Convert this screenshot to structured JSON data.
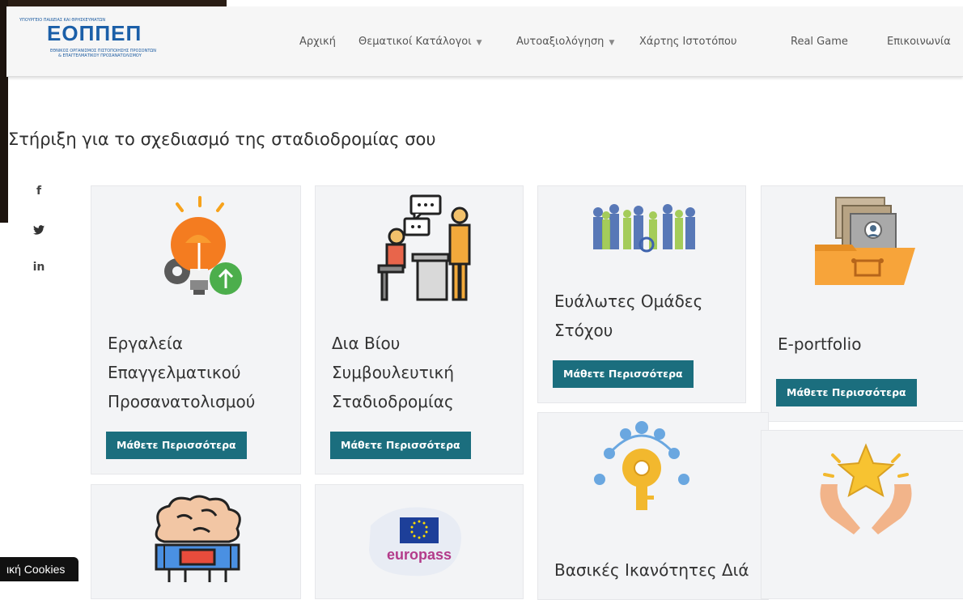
{
  "header": {
    "logo": {
      "text": "ΕΟΠΠΕΠ",
      "tagline_top": "ΥΠΟΥΡΓΕΙΟ ΠΑΙΔΕΙΑΣ ΚΑΙ ΘΡΗΣΚΕΥΜΑΤΩΝ",
      "tagline_1": "ΕΘΝΙΚΟΣ ΟΡΓΑΝΙΣΜΟΣ ΠΙΣΤΟΠΟΙΗΣΗΣ ΠΡΟΣΟΝΤΩΝ",
      "tagline_2": "& ΕΠΑΓΓΕΛΜΑΤΙΚΟΥ ΠΡΟΣΑΝΑΤΟΛΙΣΜΟΥ"
    },
    "nav": [
      {
        "label": "Αρχική",
        "dropdown": false
      },
      {
        "label": "Θεματικοί Κατάλογοι",
        "dropdown": true
      },
      {
        "label": "Αυτοαξιολόγηση",
        "dropdown": true
      },
      {
        "label": "Χάρτης Ιστοτόπου",
        "dropdown": false
      },
      {
        "label": "Real Game",
        "dropdown": false
      },
      {
        "label": "Επικοινωνία",
        "dropdown": false
      }
    ]
  },
  "page_title": "Στήριξη για το σχεδιασμό της σταδιοδρομίας σου",
  "social": [
    {
      "label": "f",
      "icon": "facebook-icon"
    },
    {
      "label": "🐦",
      "icon": "twitter-icon"
    },
    {
      "label": "in",
      "icon": "linkedin-icon"
    }
  ],
  "cards": [
    {
      "title_lines": [
        "Εργαλεία",
        "Επαγγελματικού",
        "Προσανατολισμού"
      ],
      "button": "Μάθετε Περισσότερα",
      "icon": "lightbulb-gear-icon"
    },
    {
      "title_lines": [
        "Δια Βίου",
        "Συμβουλευτική",
        "Σταδιοδρομίας"
      ],
      "button": "Μάθετε Περισσότερα",
      "icon": "counseling-icon"
    },
    {
      "title_lines": [
        "Ευάλωτες Ομάδες",
        "Στόχου"
      ],
      "button": "Μάθετε Περισσότερα",
      "icon": "people-group-icon"
    },
    {
      "title_lines": [
        "E-portfolio"
      ],
      "button": "Μάθετε Περισσότερα",
      "icon": "folder-portfolio-icon"
    },
    {
      "title_lines": [
        "Βασικές Ικανότητες Διά"
      ],
      "button": "",
      "icon": "key-network-icon"
    },
    {
      "title_lines": [],
      "button": "",
      "icon": "brain-chip-icon"
    },
    {
      "title_lines": [],
      "button": "",
      "icon": "europass-icon",
      "logo_text": "europass"
    },
    {
      "title_lines": [],
      "button": "",
      "icon": "hands-star-icon"
    }
  ],
  "cookie_bar": {
    "label": "ική Cookies"
  },
  "colors": {
    "button": "#1b6e7e",
    "brand_blue": "#1b5fa8",
    "brand_orange": "#f2a100",
    "card_bg": "#f3f4f6"
  }
}
